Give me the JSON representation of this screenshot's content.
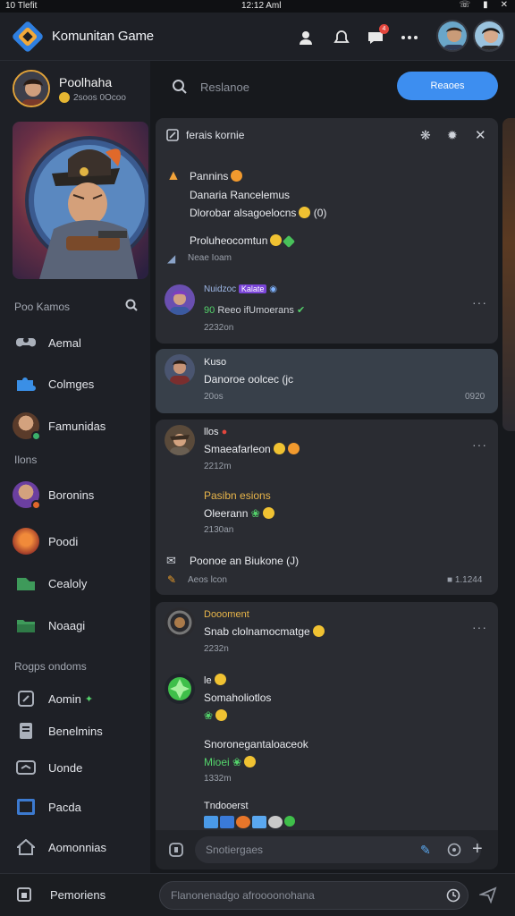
{
  "status_bar": {
    "left": "10 Tlefit",
    "center": "12:12 Aml",
    "right_icons": [
      "phone-icon",
      "battery-icon",
      "close-icon"
    ]
  },
  "header": {
    "app_title": "Komunitan Game",
    "notif_count": "4",
    "icons": [
      "user-icon",
      "notification-bell-icon",
      "chat-icon",
      "more-icon"
    ]
  },
  "user": {
    "name": "Poolhaha",
    "sub": "2soos 0Ocoo"
  },
  "sidebar": {
    "section1_title": "Poo Kamos",
    "items1": [
      {
        "label": "Aemal",
        "icon": "controller-icon"
      },
      {
        "label": "Colmges",
        "icon": "puzzle-icon"
      },
      {
        "label": "Famunidas",
        "icon": "avatar-icon"
      }
    ],
    "section2_title": "Ilons",
    "items2": [
      {
        "label": "Boronins",
        "icon": "avatar-icon"
      },
      {
        "label": "Poodi",
        "icon": "avatar-icon"
      },
      {
        "label": "Cealoly",
        "icon": "leaf-icon"
      },
      {
        "label": "Noaagi",
        "icon": "folder-icon"
      }
    ],
    "section3_title": "Rogps ondoms",
    "items3": [
      {
        "label": "Aomin",
        "icon": "edit-icon"
      },
      {
        "label": "Benelmins",
        "icon": "document-icon"
      },
      {
        "label": "Uonde",
        "icon": "tv-icon"
      },
      {
        "label": "Pacda",
        "icon": "screen-icon"
      },
      {
        "label": "Aomonnias",
        "icon": "home-icon"
      }
    ],
    "bottom_label": "Pemoriens"
  },
  "search": {
    "placeholder": "Reslanoe"
  },
  "cta": {
    "label": "Reaoes"
  },
  "panel1": {
    "title": "ferais kornie",
    "header_icons": [
      "settings-icon",
      "gear-icon",
      "close-icon"
    ],
    "msg1_name": "Pannins",
    "msg1_line1": "Danaria Rancelemus",
    "msg1_line2": "Dlorobar alsagoelocns",
    "msg1_suffix": "(0)",
    "msg2": "Proluheocomtun",
    "note": "Neae Ioam",
    "user_name": "Nuidzoc",
    "user_tag": "Kalate",
    "user_line": "Reeo ifUmoerans",
    "user_line_num": "90",
    "user_time": "2232on"
  },
  "panel2": {
    "name": "Kuso",
    "line": "Danoroe oolcec (jc",
    "time": "20os",
    "right_meta": "0920"
  },
  "panel3": {
    "name": "llos",
    "line": "Smaeafarleon",
    "time": "2212m",
    "sub_name": "Pasibn esions",
    "sub_line": "Oleerann",
    "sub_time": "2130an",
    "mail_line": "Poonoe an Biukone (J)",
    "note": "Aeos lcon",
    "right_meta": "1.1244"
  },
  "panel4": {
    "name": "Doooment",
    "line": "Snab clolnamocmatge",
    "time": "2232n",
    "m2_name": "le",
    "m2_line": "Somaholiotlos",
    "m3_line": "Snoronegantaloaceok",
    "m3_sub": "Mioei",
    "m3_time": "1332m",
    "m4_name": "Tndooerst"
  },
  "composer": {
    "placeholder": "Snotiergaes"
  },
  "bottom": {
    "placeholder": "Flanonenadgo afroooonohana"
  },
  "colors": {
    "accent": "#3d8ef0",
    "gold": "#e8b54a",
    "green": "#54d36b",
    "badge": "#e2463d"
  }
}
